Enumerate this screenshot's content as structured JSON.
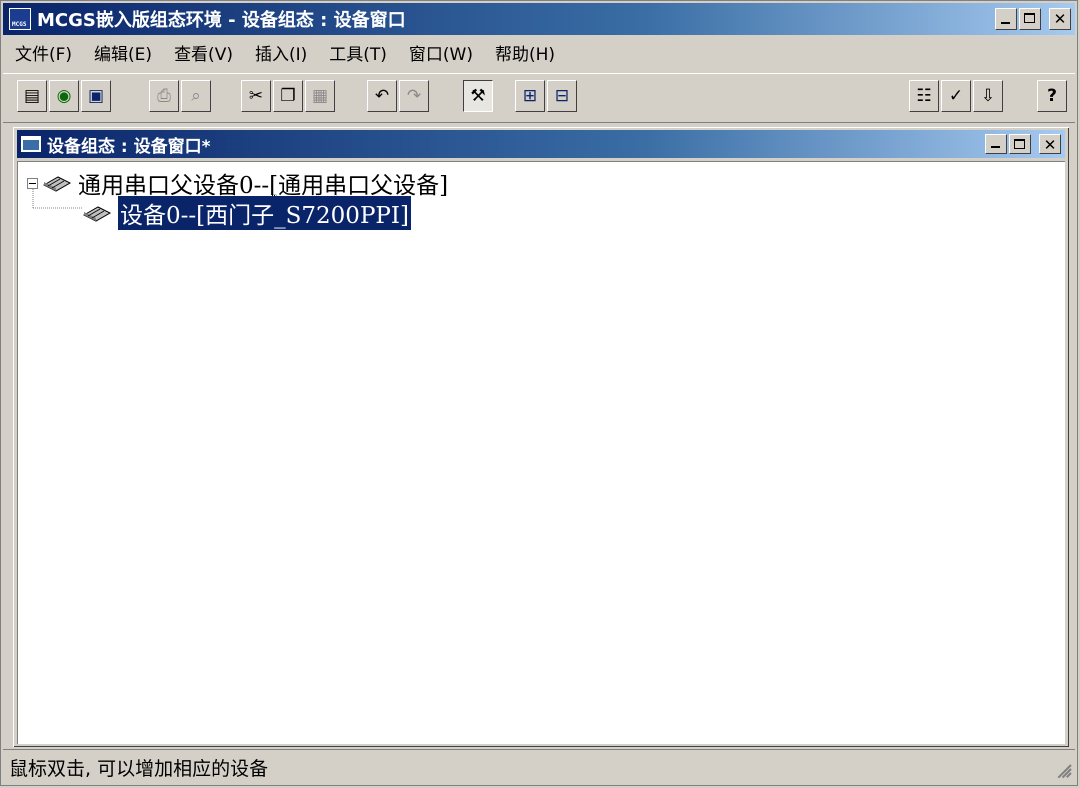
{
  "window": {
    "title": "MCGS嵌入版组态环境 - 设备组态 : 设备窗口",
    "icon_label": "MCGS"
  },
  "menu": [
    {
      "label": "文件(F)"
    },
    {
      "label": "编辑(E)"
    },
    {
      "label": "查看(V)"
    },
    {
      "label": "插入(I)"
    },
    {
      "label": "工具(T)"
    },
    {
      "label": "窗口(W)"
    },
    {
      "label": "帮助(H)"
    }
  ],
  "toolbar": {
    "icons": [
      "new-window-icon",
      "database-icon",
      "save-icon",
      "print-icon",
      "print-preview-icon",
      "cut-icon",
      "copy-icon",
      "paste-icon",
      "undo-icon",
      "redo-icon",
      "device-tools-icon",
      "device-add-icon",
      "device-tree-icon",
      "properties-icon",
      "check-icon",
      "sort-icon",
      "help-icon"
    ]
  },
  "child_window": {
    "title": "设备组态 : 设备窗口*"
  },
  "tree": {
    "parent_label": "通用串口父设备0--[通用串口父设备]",
    "child_label": "设备0--[西门子_S7200PPI]"
  },
  "status": {
    "text": "鼠标双击, 可以增加相应的设备"
  },
  "colors": {
    "title_active": "#0a246a",
    "title_gradient_end": "#a6caf0",
    "selection": "#0a246a",
    "face": "#d4d0c8"
  }
}
